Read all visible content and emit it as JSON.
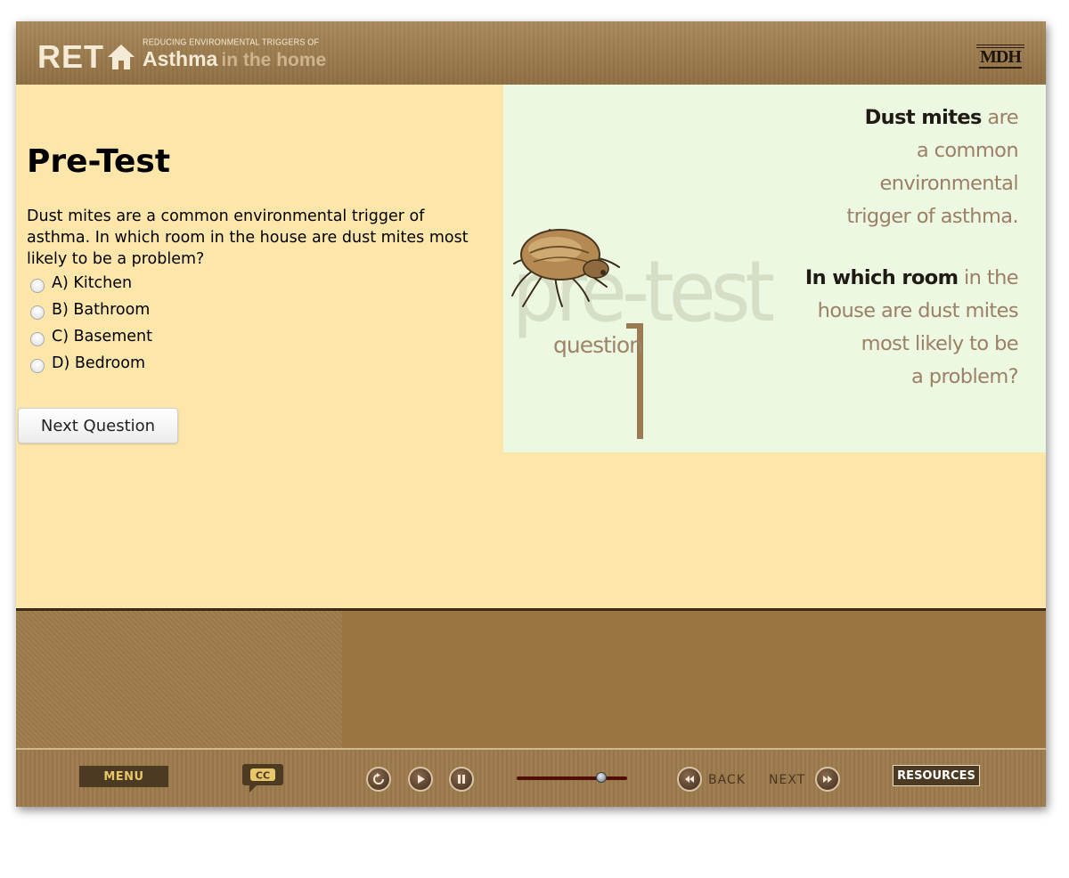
{
  "header": {
    "logo_ret": "RET",
    "logo_tagline": "REDUCING ENVIRONMENTAL TRIGGERS OF",
    "logo_asthma": "Asthma",
    "logo_home": "in the home",
    "mdh_logo": "MDH",
    "colors": {
      "header_bg": "#9a7442",
      "logo_text": "#f4ead6"
    }
  },
  "main": {
    "title": "Pre-Test",
    "question": "Dust mites are a common environmental trigger of asthma. In which room in the house are dust mites most likely to be a problem?",
    "options": [
      {
        "label": "A) Kitchen",
        "selected": false
      },
      {
        "label": "B) Bathroom",
        "selected": false
      },
      {
        "label": "C) Basement",
        "selected": false
      },
      {
        "label": "D) Bedroom",
        "selected": false
      }
    ],
    "next_button": "Next Question",
    "colors": {
      "content_bg": "#fce6aa",
      "panel_bg": "#edf8e2"
    }
  },
  "illustration": {
    "watermark": "pre-test",
    "question_word": "question",
    "question_number": "1",
    "icon": "dust-mite-icon",
    "text1_bold": "Dust mites",
    "text1_rest": "are",
    "text1_lines": [
      "a common",
      "environmental",
      "trigger of asthma."
    ],
    "text2_bold": "In which room",
    "text2_rest": "in the",
    "text2_lines": [
      "house are dust mites",
      "most likely to be",
      "a problem?"
    ]
  },
  "controls": {
    "menu": "MENU",
    "cc": "CC",
    "replay_icon": "replay-icon",
    "play_icon": "play-icon",
    "pause_icon": "pause-icon",
    "progress": 0.77,
    "back": "BACK",
    "next": "NEXT",
    "resources": "RESOURCES"
  }
}
